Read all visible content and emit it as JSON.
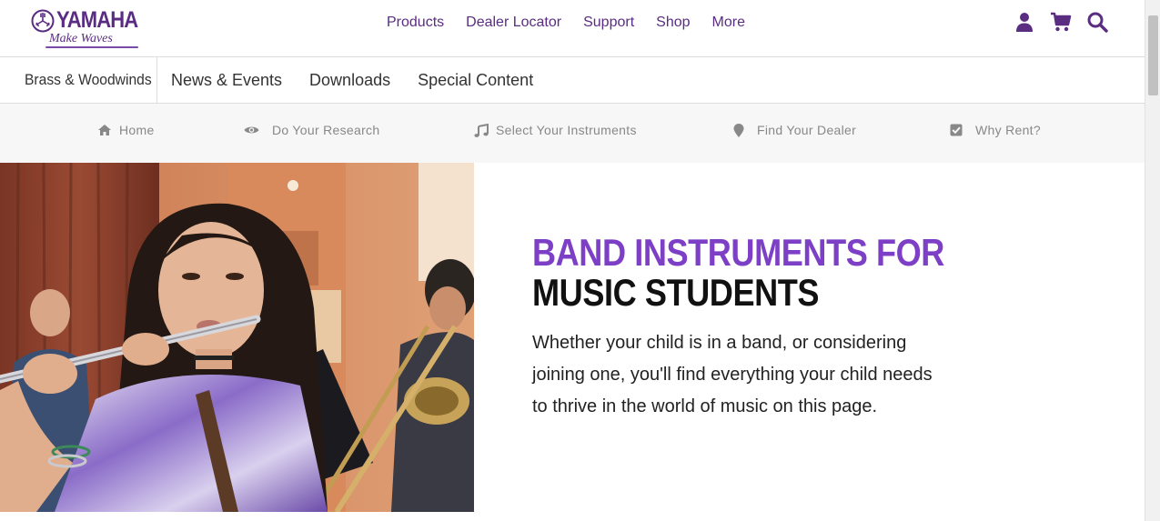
{
  "brand": {
    "name": "YAMAHA",
    "tagline": "Make Waves",
    "color": "#5a2d82"
  },
  "topnav": [
    "Products",
    "Dealer Locator",
    "Support",
    "Shop",
    "More"
  ],
  "utility": {
    "icons": [
      "user-icon",
      "cart-icon",
      "search-icon"
    ]
  },
  "subnav": {
    "brand": "Brass & Woodwinds",
    "links": [
      "News & Events",
      "Downloads",
      "Special Content"
    ]
  },
  "steps": [
    {
      "label": "Home",
      "icon": "home-icon"
    },
    {
      "label": "Do Your Research",
      "icon": "eye-icon"
    },
    {
      "label": "Select Your Instruments",
      "icon": "music-note-icon"
    },
    {
      "label": "Find Your Dealer",
      "icon": "map-pin-icon"
    },
    {
      "label": "Why Rent?",
      "icon": "check-square-icon"
    }
  ],
  "hero": {
    "title_accent": "BAND INSTRUMENTS FOR",
    "title_dark": "MUSIC STUDENTS",
    "body": "Whether your child is in a band, or considering joining one, you'll find everything your child needs to thrive in the world of music on this page.",
    "accent_color": "#7d3fc6",
    "photo_alt": "student-playing-flute-photo"
  }
}
